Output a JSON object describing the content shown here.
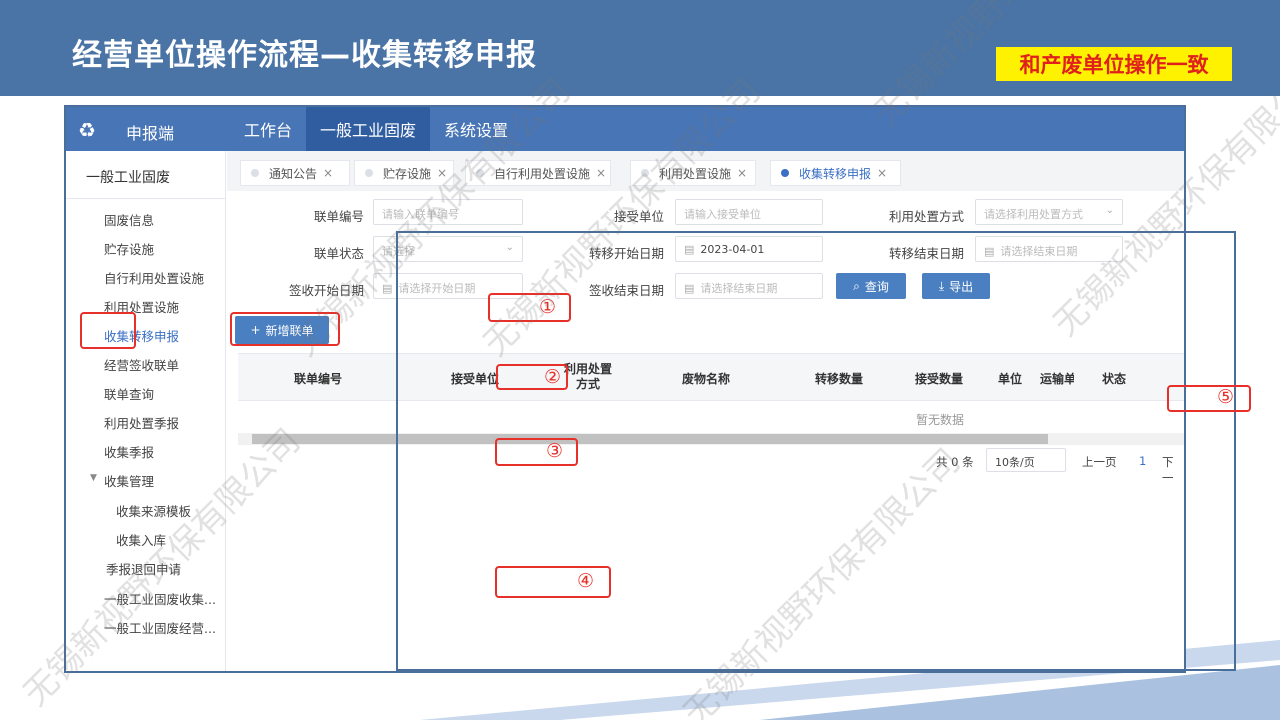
{
  "slide": {
    "title": "经营单位操作流程—收集转移申报",
    "note": "和产废单位操作一致",
    "watermark": "无锡新视野环保有限公司"
  },
  "app": {
    "name": "申报端",
    "nav": [
      "工作台",
      "一般工业固废",
      "系统设置"
    ],
    "nav_active": "一般工业固废"
  },
  "sidebar": {
    "header": "一般工业固废",
    "items": [
      "固废信息",
      "贮存设施",
      "自行利用处置设施",
      "利用处置设施",
      "收集转移申报",
      "经营签收联单",
      "联单查询",
      "利用处置季报",
      "收集季报",
      "收集管理",
      "收集来源模板",
      "收集入库",
      "季报退回申请",
      "一般工业固废收集...",
      "一般工业固废经营..."
    ],
    "active": "收集转移申报"
  },
  "tabs": [
    "通知公告",
    "贮存设施",
    "自行利用处置设施",
    "利用处置设施",
    "收集转移申报"
  ],
  "filters": {
    "bill_no_label": "联单编号",
    "bill_no_placeholder": "请输入联单编号",
    "receiver_label": "接受单位",
    "receiver_placeholder": "请输入接受单位",
    "method_label": "利用处置方式",
    "method_placeholder": "请选择利用处置方式",
    "status_label": "联单状态",
    "status_value": "请选择",
    "start_label": "转移开始日期",
    "start_value": "2023-04-01",
    "end_label": "转移结束日期",
    "end_placeholder": "请选择结束日期",
    "sign_start_label": "签收开始日期",
    "sign_start_placeholder": "请选择开始日期",
    "sign_end_label": "签收结束日期",
    "sign_end_placeholder": "请选择结束日期",
    "query": "查询",
    "export": "导出"
  },
  "add_button": "新增联单",
  "table": {
    "columns": [
      "联单编号",
      "接受单位",
      "利用处置方式",
      "废物名称",
      "转移数量",
      "接受数量",
      "单位",
      "运输单",
      "状态"
    ],
    "empty": "暂无数据"
  },
  "pagination": {
    "total": "共 0 条",
    "page_size": "10条/页",
    "prev": "上一页",
    "page": "1",
    "next": "下一"
  },
  "callouts": [
    "①",
    "②",
    "③",
    "④",
    "⑤"
  ],
  "colors": {
    "header": "#4a74a6",
    "app_bar": "#4875b5",
    "callout": "#e8302a",
    "note_bg": "#fff200"
  }
}
